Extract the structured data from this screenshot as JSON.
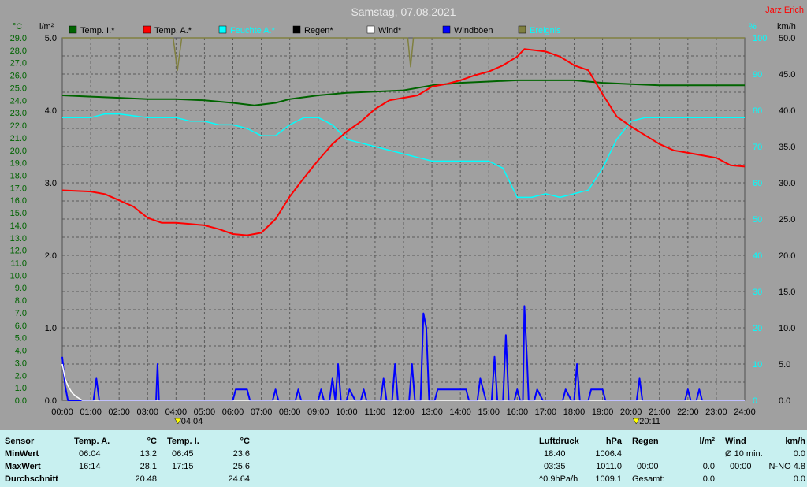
{
  "title": "Samstag, 07.08.2021",
  "owner": "Jarz Erich",
  "axis_units": {
    "temp": "°C",
    "rain": "l/m²",
    "humidity": "%",
    "wind": "km/h"
  },
  "legend": [
    {
      "label": "Temp. I.*",
      "color": "#006400"
    },
    {
      "label": "Temp. A.*",
      "color": "#ff0000"
    },
    {
      "label": "Feuchte A.*",
      "color": "#00ffff"
    },
    {
      "label": "Regen*",
      "color": "#000000"
    },
    {
      "label": "Wind*",
      "color": "#ffffff"
    },
    {
      "label": "Windböen",
      "color": "#0000ff"
    },
    {
      "label": "Ereignis",
      "color": "#808040"
    }
  ],
  "chart_data": {
    "type": "line",
    "title": "Samstag, 07.08.2021",
    "x_ticks": [
      "00:00",
      "01:00",
      "02:00",
      "03:00",
      "04:00",
      "05:00",
      "06:00",
      "07:00",
      "08:00",
      "09:00",
      "10:00",
      "11:00",
      "12:00",
      "13:00",
      "14:00",
      "15:00",
      "16:00",
      "17:00",
      "18:00",
      "19:00",
      "20:00",
      "21:00",
      "22:00",
      "23:00",
      "24:00"
    ],
    "x_range_hours": [
      0,
      24
    ],
    "sunrise": "04:04",
    "sunset": "20:11",
    "temp_axis": {
      "label": "°C",
      "min": 0,
      "max": 29,
      "ticks": [
        "0.0",
        "1.0",
        "2.0",
        "3.0",
        "4.0",
        "5.0",
        "6.0",
        "7.0",
        "8.0",
        "9.0",
        "10.0",
        "11.0",
        "12.0",
        "13.0",
        "14.0",
        "15.0",
        "16.0",
        "17.0",
        "18.0",
        "19.0",
        "20.0",
        "21.0",
        "22.0",
        "23.0",
        "24.0",
        "25.0",
        "26.0",
        "27.0",
        "28.0",
        "29.0"
      ]
    },
    "rain_axis": {
      "label": "l/m²",
      "min": 0,
      "max": 5,
      "ticks": [
        "0.0",
        "1.0",
        "2.0",
        "3.0",
        "4.0",
        "5.0"
      ]
    },
    "humidity_axis": {
      "label": "%",
      "min": 0,
      "max": 100,
      "ticks": [
        "0",
        "10",
        "20",
        "30",
        "40",
        "50",
        "60",
        "70",
        "80",
        "90",
        "100"
      ]
    },
    "wind_axis": {
      "label": "km/h",
      "min": 0,
      "max": 50,
      "ticks": [
        "0.0",
        "5.0",
        "10.0",
        "15.0",
        "20.0",
        "25.0",
        "30.0",
        "35.0",
        "40.0",
        "45.0",
        "50.0"
      ]
    },
    "grid": true,
    "series": [
      {
        "name": "Temp. A.*",
        "color": "#ff0000",
        "axis": "temp",
        "points": [
          [
            0,
            16.8
          ],
          [
            1,
            16.7
          ],
          [
            1.5,
            16.5
          ],
          [
            2,
            16.0
          ],
          [
            2.5,
            15.5
          ],
          [
            3,
            14.6
          ],
          [
            3.5,
            14.2
          ],
          [
            4,
            14.2
          ],
          [
            4.5,
            14.1
          ],
          [
            5,
            14.0
          ],
          [
            5.5,
            13.7
          ],
          [
            6,
            13.3
          ],
          [
            6.5,
            13.2
          ],
          [
            7,
            13.4
          ],
          [
            7.5,
            14.5
          ],
          [
            8,
            16.3
          ],
          [
            8.5,
            17.8
          ],
          [
            9,
            19.2
          ],
          [
            9.5,
            20.5
          ],
          [
            10,
            21.5
          ],
          [
            10.5,
            22.3
          ],
          [
            11,
            23.3
          ],
          [
            11.5,
            24.0
          ],
          [
            12,
            24.2
          ],
          [
            12.5,
            24.4
          ],
          [
            13,
            25.1
          ],
          [
            13.5,
            25.3
          ],
          [
            14,
            25.6
          ],
          [
            14.5,
            26.0
          ],
          [
            15,
            26.3
          ],
          [
            15.5,
            26.8
          ],
          [
            16,
            27.5
          ],
          [
            16.25,
            28.1
          ],
          [
            17,
            27.9
          ],
          [
            17.5,
            27.5
          ],
          [
            18,
            26.8
          ],
          [
            18.5,
            26.4
          ],
          [
            19,
            24.5
          ],
          [
            19.5,
            22.7
          ],
          [
            20,
            21.9
          ],
          [
            20.5,
            21.2
          ],
          [
            21,
            20.5
          ],
          [
            21.5,
            20.0
          ],
          [
            22,
            19.8
          ],
          [
            22.5,
            19.6
          ],
          [
            23,
            19.4
          ],
          [
            23.5,
            18.8
          ],
          [
            24,
            18.7
          ]
        ]
      },
      {
        "name": "Temp. I.*",
        "color": "#006400",
        "axis": "temp",
        "points": [
          [
            0,
            24.4
          ],
          [
            1,
            24.3
          ],
          [
            2,
            24.2
          ],
          [
            3,
            24.1
          ],
          [
            4,
            24.1
          ],
          [
            5,
            24.0
          ],
          [
            6,
            23.8
          ],
          [
            6.75,
            23.6
          ],
          [
            7.5,
            23.8
          ],
          [
            8,
            24.1
          ],
          [
            9,
            24.4
          ],
          [
            10,
            24.6
          ],
          [
            11,
            24.7
          ],
          [
            12,
            24.8
          ],
          [
            13,
            25.2
          ],
          [
            14,
            25.4
          ],
          [
            15,
            25.5
          ],
          [
            16,
            25.6
          ],
          [
            17,
            25.6
          ],
          [
            17.25,
            25.6
          ],
          [
            18,
            25.6
          ],
          [
            19,
            25.4
          ],
          [
            20,
            25.3
          ],
          [
            21,
            25.2
          ],
          [
            22,
            25.2
          ],
          [
            23,
            25.2
          ],
          [
            24,
            25.2
          ]
        ]
      },
      {
        "name": "Feuchte A.*",
        "color": "#00ffff",
        "axis": "humidity",
        "points": [
          [
            0,
            78
          ],
          [
            1,
            78
          ],
          [
            1.5,
            79
          ],
          [
            2,
            79
          ],
          [
            3,
            78
          ],
          [
            4,
            78
          ],
          [
            4.5,
            77
          ],
          [
            5,
            77
          ],
          [
            5.5,
            76
          ],
          [
            6,
            76
          ],
          [
            6.5,
            75
          ],
          [
            7,
            73
          ],
          [
            7.5,
            73
          ],
          [
            8,
            76
          ],
          [
            8.5,
            78
          ],
          [
            9,
            78
          ],
          [
            9.5,
            76
          ],
          [
            10,
            72
          ],
          [
            11,
            70
          ],
          [
            12,
            68
          ],
          [
            13,
            66
          ],
          [
            14,
            66
          ],
          [
            14.5,
            66
          ],
          [
            15,
            66
          ],
          [
            15.5,
            64
          ],
          [
            16,
            56
          ],
          [
            16.5,
            56
          ],
          [
            17,
            57
          ],
          [
            17.5,
            56
          ],
          [
            18,
            57
          ],
          [
            18.5,
            58
          ],
          [
            19,
            64
          ],
          [
            19.5,
            72
          ],
          [
            20,
            77
          ],
          [
            20.5,
            78
          ],
          [
            21,
            78
          ],
          [
            22,
            78
          ],
          [
            23,
            78
          ],
          [
            24,
            78
          ]
        ]
      },
      {
        "name": "Wind*",
        "color": "#ffffff",
        "axis": "wind",
        "points": [
          [
            0,
            5
          ],
          [
            0.1,
            3
          ],
          [
            0.2,
            2
          ],
          [
            0.35,
            1
          ],
          [
            0.5,
            0.5
          ],
          [
            0.7,
            0
          ],
          [
            24,
            0
          ]
        ]
      },
      {
        "name": "Windböen",
        "color": "#0000ff",
        "axis": "wind",
        "points": [
          [
            0,
            6
          ],
          [
            0.1,
            2
          ],
          [
            0.2,
            0
          ],
          [
            1.1,
            0
          ],
          [
            1.2,
            3
          ],
          [
            1.3,
            0
          ],
          [
            3.3,
            0
          ],
          [
            3.35,
            5
          ],
          [
            3.4,
            0
          ],
          [
            6.0,
            0
          ],
          [
            6.1,
            1.5
          ],
          [
            6.5,
            1.5
          ],
          [
            6.6,
            0
          ],
          [
            7.4,
            0
          ],
          [
            7.5,
            1.5
          ],
          [
            7.6,
            0
          ],
          [
            8.2,
            0
          ],
          [
            8.3,
            1.5
          ],
          [
            8.4,
            0
          ],
          [
            9.0,
            0
          ],
          [
            9.1,
            1.5
          ],
          [
            9.2,
            0
          ],
          [
            9.4,
            0
          ],
          [
            9.5,
            3
          ],
          [
            9.6,
            0
          ],
          [
            9.7,
            5
          ],
          [
            9.8,
            0
          ],
          [
            10.0,
            0
          ],
          [
            10.1,
            1.5
          ],
          [
            10.3,
            0
          ],
          [
            10.5,
            0
          ],
          [
            10.6,
            1.5
          ],
          [
            10.7,
            0
          ],
          [
            11.2,
            0
          ],
          [
            11.3,
            3
          ],
          [
            11.4,
            0
          ],
          [
            11.6,
            0
          ],
          [
            11.7,
            5
          ],
          [
            11.8,
            0
          ],
          [
            12.2,
            0
          ],
          [
            12.3,
            5
          ],
          [
            12.4,
            0
          ],
          [
            12.6,
            0
          ],
          [
            12.7,
            12
          ],
          [
            12.8,
            10
          ],
          [
            12.9,
            0
          ],
          [
            13.1,
            0
          ],
          [
            13.2,
            1.5
          ],
          [
            14.2,
            1.5
          ],
          [
            14.3,
            0
          ],
          [
            14.6,
            0
          ],
          [
            14.7,
            3
          ],
          [
            14.9,
            0
          ],
          [
            15.1,
            0
          ],
          [
            15.2,
            6
          ],
          [
            15.3,
            0
          ],
          [
            15.5,
            0
          ],
          [
            15.6,
            9
          ],
          [
            15.7,
            0
          ],
          [
            15.9,
            0
          ],
          [
            16.0,
            1.5
          ],
          [
            16.1,
            0
          ],
          [
            16.2,
            0
          ],
          [
            16.25,
            13
          ],
          [
            16.35,
            5
          ],
          [
            16.4,
            0
          ],
          [
            16.6,
            0
          ],
          [
            16.7,
            1.5
          ],
          [
            16.9,
            0
          ],
          [
            17.6,
            0
          ],
          [
            17.7,
            1.5
          ],
          [
            17.9,
            0
          ],
          [
            18.0,
            0
          ],
          [
            18.1,
            5
          ],
          [
            18.2,
            0
          ],
          [
            18.5,
            0
          ],
          [
            18.6,
            1.5
          ],
          [
            19.0,
            1.5
          ],
          [
            19.1,
            0
          ],
          [
            20.2,
            0
          ],
          [
            20.3,
            3
          ],
          [
            20.4,
            0
          ],
          [
            21.9,
            0
          ],
          [
            22.0,
            1.5
          ],
          [
            22.1,
            0
          ],
          [
            22.3,
            0
          ],
          [
            22.4,
            1.5
          ],
          [
            22.5,
            0
          ],
          [
            24,
            0
          ]
        ]
      },
      {
        "name": "Ereignis",
        "color": "#808040",
        "axis": "humidity",
        "points": [
          [
            0,
            100
          ],
          [
            3.9,
            100
          ],
          [
            4.05,
            91
          ],
          [
            4.2,
            100
          ],
          [
            12.15,
            100
          ],
          [
            12.25,
            92
          ],
          [
            12.35,
            100
          ],
          [
            24,
            100
          ]
        ]
      }
    ]
  },
  "stats": {
    "sensor": {
      "header": "Sensor",
      "rows": [
        "MinWert",
        "MaxWert",
        "Durchschnitt"
      ]
    },
    "temp_a": {
      "header": "Temp. A.",
      "unit": "°C",
      "min_time": "06:04",
      "min_val": "13.2",
      "max_time": "16:14",
      "max_val": "28.1",
      "avg": "20.48"
    },
    "temp_i": {
      "header": "Temp. I.",
      "unit": "°C",
      "min_time": "06:45",
      "min_val": "23.6",
      "max_time": "17:15",
      "max_val": "25.6",
      "avg": "24.64"
    },
    "pressure": {
      "header": "Luftdruck",
      "unit": "hPa",
      "min_time": "18:40",
      "min_val": "1006.4",
      "max_time": "03:35",
      "max_val": "1011.0",
      "trend": "^0.9hPa/h",
      "avg": "1009.1"
    },
    "rain": {
      "header": "Regen",
      "unit": "l/m²",
      "time": "00:00",
      "val": "0.0",
      "total_label": "Gesamt:",
      "total": "0.0"
    },
    "wind": {
      "header": "Wind",
      "unit": "km/h",
      "avg_label": "Ø 10 min.",
      "avg_val": "0.0",
      "max_time": "00:00",
      "max_val": "N-NO 4.8",
      "avg3": "0.0"
    }
  }
}
